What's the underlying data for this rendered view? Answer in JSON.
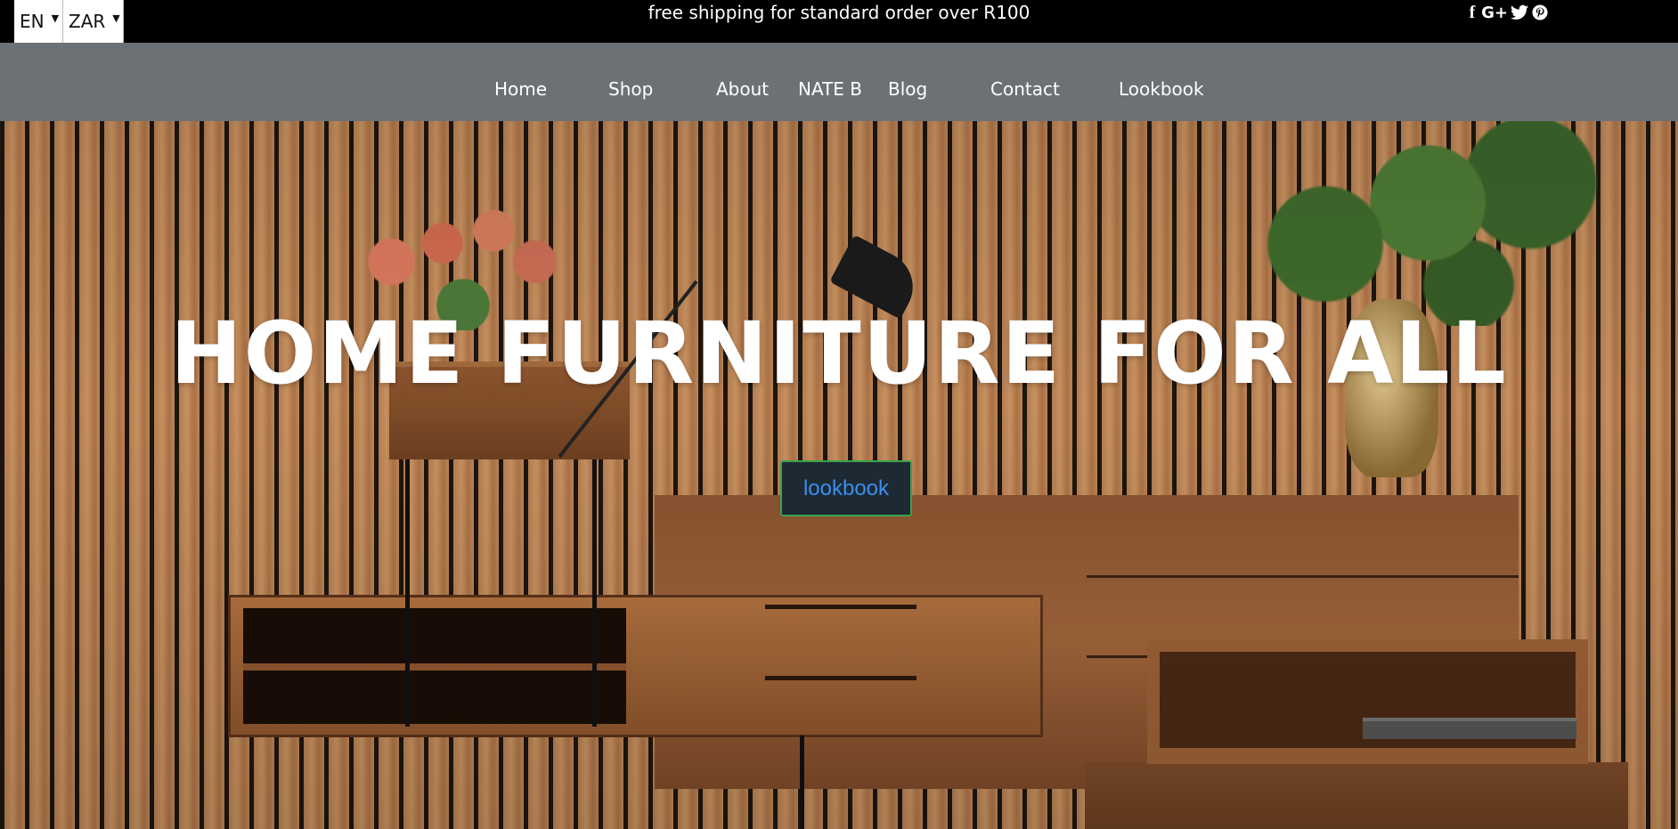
{
  "topbar": {
    "language": {
      "selected": "EN"
    },
    "currency": {
      "selected": "ZAR"
    },
    "announcement": "free shipping for standard order over R100",
    "social": [
      {
        "icon": "facebook-icon",
        "glyph": "f"
      },
      {
        "icon": "google-plus-icon",
        "glyph": "G+"
      },
      {
        "icon": "twitter-icon"
      },
      {
        "icon": "pinterest-icon"
      }
    ]
  },
  "nav": {
    "items": [
      {
        "label": "Home"
      },
      {
        "label": "Shop"
      },
      {
        "label": "About"
      },
      {
        "label": "NATE B"
      },
      {
        "label": "Blog"
      },
      {
        "label": "Contact"
      },
      {
        "label": "Lookbook"
      }
    ]
  },
  "hero": {
    "title": "HOME FURNITURE FOR ALL",
    "button_label": "lookbook"
  },
  "colors": {
    "topbar_bg": "#000000",
    "nav_bg": "#6c7175",
    "button_bg": "#1e2a33",
    "button_border": "#3aa34a",
    "button_text": "#3a8ef0"
  }
}
